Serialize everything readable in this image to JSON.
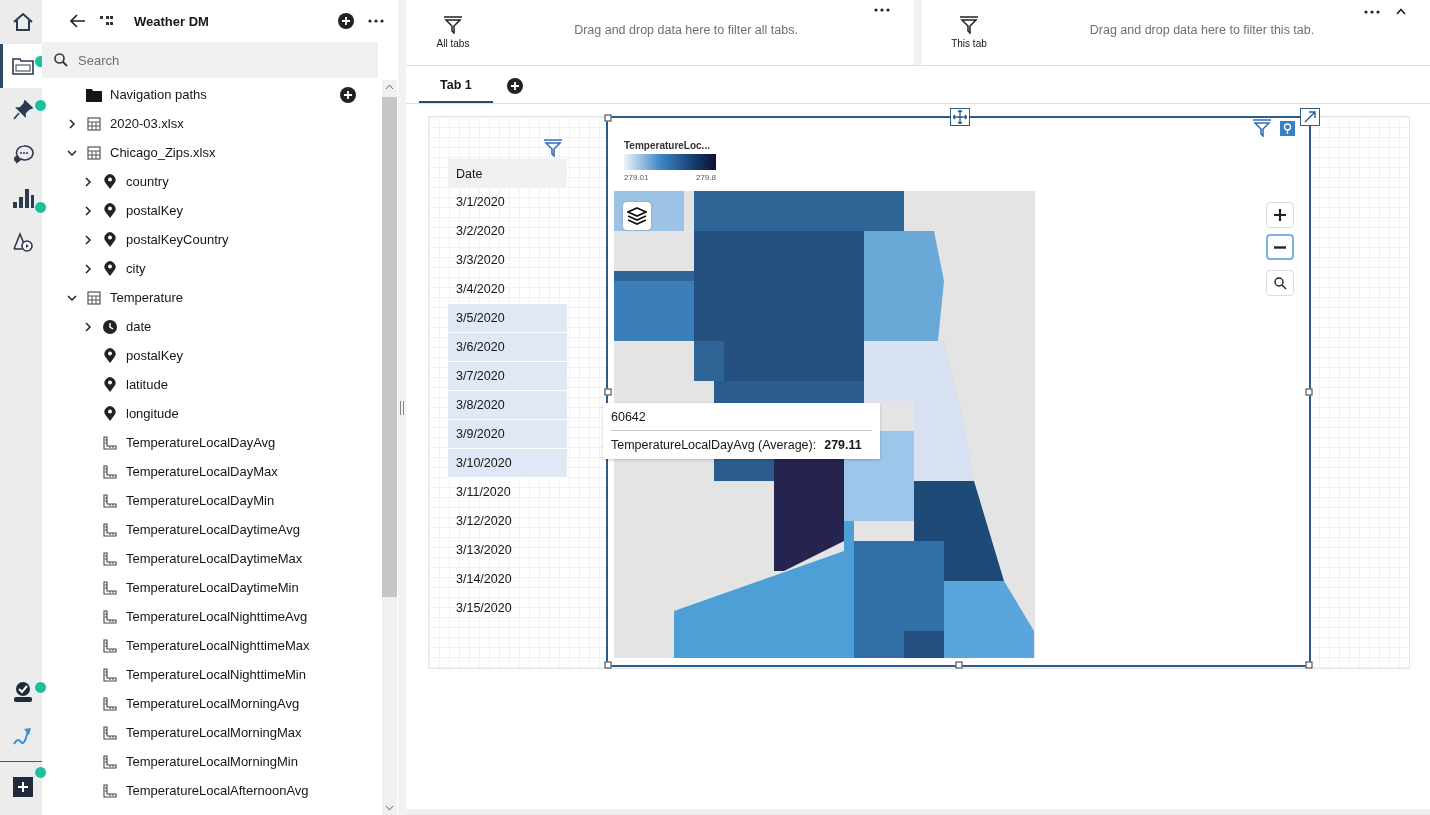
{
  "rail": {
    "top": [
      {
        "kind": "home",
        "selected": false,
        "badge": false
      },
      {
        "kind": "data",
        "selected": true,
        "badge": true
      },
      {
        "kind": "pin",
        "selected": false,
        "badge": true
      },
      {
        "kind": "chat",
        "selected": false,
        "badge": false
      },
      {
        "kind": "chart",
        "selected": false,
        "badge": true
      },
      {
        "kind": "shapes",
        "selected": false,
        "badge": false
      }
    ],
    "bottom": [
      {
        "kind": "reviewer",
        "selected": false,
        "badge": true
      },
      {
        "kind": "arrow",
        "selected": false,
        "badge": false
      },
      {
        "kind": "add",
        "selected": false,
        "badge": true
      }
    ]
  },
  "source_panel": {
    "title": "Weather DM",
    "search": {
      "placeholder": "Search"
    },
    "tree": [
      {
        "kind": "folder",
        "label": "Navigation paths"
      },
      {
        "kind": "table",
        "label": "2020-03.xlsx",
        "expanded": false
      },
      {
        "kind": "table",
        "label": "Chicago_Zips.xlsx",
        "expanded": true,
        "children": [
          {
            "kind": "location",
            "label": "country",
            "expanded": false
          },
          {
            "kind": "location",
            "label": "postalKey",
            "expanded": false
          },
          {
            "kind": "location",
            "label": "postalKeyCountry",
            "expanded": false
          },
          {
            "kind": "location",
            "label": "city",
            "expanded": false
          }
        ]
      },
      {
        "kind": "table",
        "label": "Temperature",
        "expanded": true,
        "children": [
          {
            "kind": "time",
            "label": "date",
            "expanded": false
          },
          {
            "kind": "location",
            "label": "postalKey"
          },
          {
            "kind": "location",
            "label": "latitude"
          },
          {
            "kind": "location",
            "label": "longitude"
          },
          {
            "kind": "measure",
            "label": "TemperatureLocalDayAvg"
          },
          {
            "kind": "measure",
            "label": "TemperatureLocalDayMax"
          },
          {
            "kind": "measure",
            "label": "TemperatureLocalDayMin"
          },
          {
            "kind": "measure",
            "label": "TemperatureLocalDaytimeAvg"
          },
          {
            "kind": "measure",
            "label": "TemperatureLocalDaytimeMax"
          },
          {
            "kind": "measure",
            "label": "TemperatureLocalDaytimeMin"
          },
          {
            "kind": "measure",
            "label": "TemperatureLocalNighttimeAvg"
          },
          {
            "kind": "measure",
            "label": "TemperatureLocalNighttimeMax"
          },
          {
            "kind": "measure",
            "label": "TemperatureLocalNighttimeMin"
          },
          {
            "kind": "measure",
            "label": "TemperatureLocalMorningAvg"
          },
          {
            "kind": "measure",
            "label": "TemperatureLocalMorningMax"
          },
          {
            "kind": "measure",
            "label": "TemperatureLocalMorningMin"
          },
          {
            "kind": "measure",
            "label": "TemperatureLocalAfternoonAvg"
          }
        ]
      }
    ]
  },
  "filters": [
    {
      "label": "All tabs",
      "hint": "Drag and drop data here to filter all tabs."
    },
    {
      "label": "This tab",
      "hint": "Drag and drop data here to filter this tab."
    }
  ],
  "tabs": [
    {
      "label": "Tab 1",
      "selected": true
    }
  ],
  "date_list": {
    "header": "Date",
    "rows": [
      {
        "label": "3/1/2020",
        "selected": false
      },
      {
        "label": "3/2/2020",
        "selected": false
      },
      {
        "label": "3/3/2020",
        "selected": false
      },
      {
        "label": "3/4/2020",
        "selected": false
      },
      {
        "label": "3/5/2020",
        "selected": true
      },
      {
        "label": "3/6/2020",
        "selected": true
      },
      {
        "label": "3/7/2020",
        "selected": true
      },
      {
        "label": "3/8/2020",
        "selected": true
      },
      {
        "label": "3/9/2020",
        "selected": true
      },
      {
        "label": "3/10/2020",
        "selected": true
      },
      {
        "label": "3/11/2020",
        "selected": false
      },
      {
        "label": "3/12/2020",
        "selected": false
      },
      {
        "label": "3/13/2020",
        "selected": false
      },
      {
        "label": "3/14/2020",
        "selected": false
      },
      {
        "label": "3/15/2020",
        "selected": false
      }
    ]
  },
  "map": {
    "legend": {
      "title": "TemperatureLoc...",
      "min": "279.01",
      "max": "279.8"
    },
    "tooltip": {
      "title": "60642",
      "label": "TemperatureLocalDayAvg (Average):",
      "value": "279.11"
    }
  }
}
